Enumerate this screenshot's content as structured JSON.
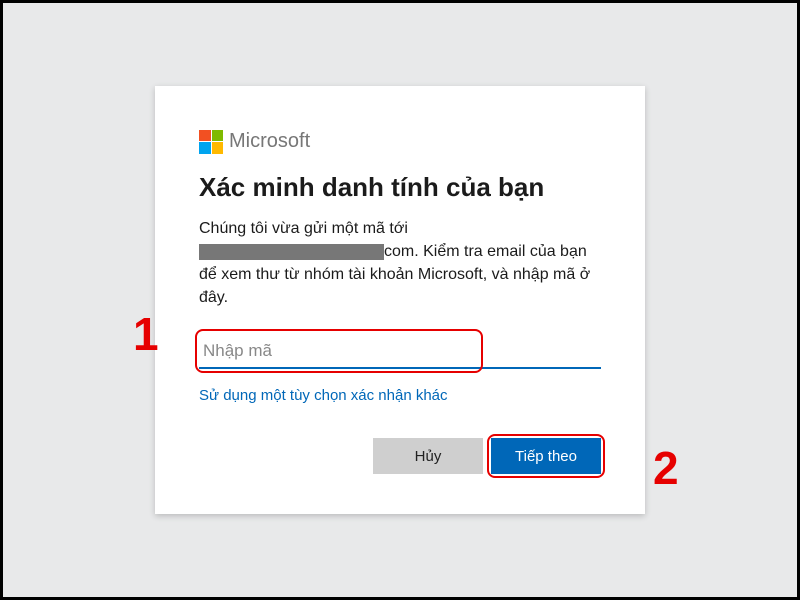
{
  "logo": {
    "text": "Microsoft"
  },
  "title": "Xác minh danh tính của bạn",
  "desc": {
    "part1": "Chúng tôi vừa gửi một mã tới ",
    "part2": "com. Kiểm tra email của bạn để xem thư từ nhóm tài khoản Microsoft, và nhập mã ở đây."
  },
  "input": {
    "placeholder": "Nhập mã",
    "value": ""
  },
  "alt_link": "Sử dụng một tùy chọn xác nhận khác",
  "buttons": {
    "cancel": "Hủy",
    "next": "Tiếp theo"
  },
  "annotations": {
    "label1": "1",
    "label2": "2"
  },
  "colors": {
    "primary": "#0067b8",
    "annotation": "#e60000"
  }
}
